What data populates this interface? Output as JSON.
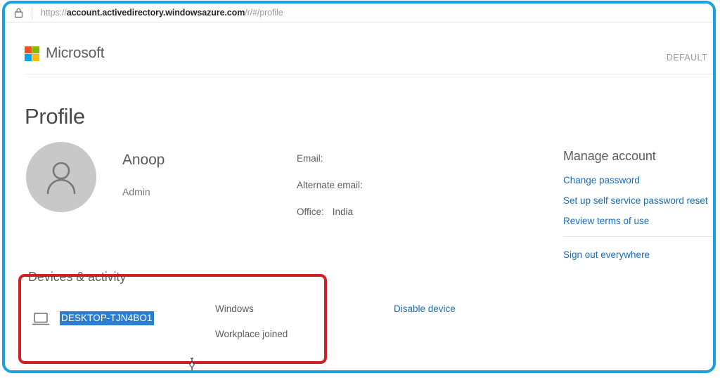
{
  "browser": {
    "lock_icon": "padlock-icon",
    "url_scheme": "https://",
    "url_domain": "account.activedirectory.windowsazure.com",
    "url_path": "/r/#/profile",
    "url_full": "https://account.activedirectory.windowsazure.com/r/#/profile"
  },
  "header": {
    "logo_text": "Microsoft",
    "logo_icon": "microsoft-logo-icon",
    "tenant_label": "DEFAULT",
    "logo_colors": {
      "top_left": "#f25022",
      "top_right": "#7fba00",
      "bottom_left": "#00a4ef",
      "bottom_right": "#ffb900"
    }
  },
  "page": {
    "title": "Profile"
  },
  "profile": {
    "avatar_icon": "person-avatar-icon",
    "name": "Anoop",
    "role": "Admin",
    "details": [
      {
        "label": "Email:",
        "value": ""
      },
      {
        "label": "Alternate email:",
        "value": ""
      },
      {
        "label": "Office:",
        "value": "India"
      }
    ]
  },
  "manage_account": {
    "title": "Manage account",
    "links": [
      "Change password",
      "Set up self service password reset",
      "Review terms of use"
    ],
    "sign_out_link": "Sign out everywhere",
    "link_color": "#1a6cb8"
  },
  "devices": {
    "title": "Devices & activity",
    "device_icon": "laptop-icon",
    "device_name": "DESKTOP-TJN4BO1",
    "device_name_selected": true,
    "selection_color": "#2a7fd4",
    "os": "Windows",
    "state": "Workplace joined",
    "action_link": "Disable device"
  },
  "annotations": {
    "outer_frame_color": "#1ba1e2",
    "highlight_box_color": "#cf2028",
    "cursor_icon": "text-cursor-icon"
  }
}
